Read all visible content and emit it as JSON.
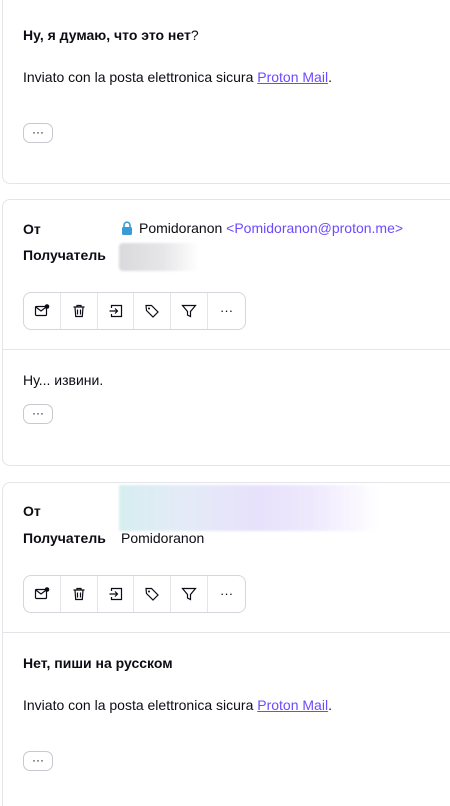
{
  "messages": [
    {
      "body_bold": "Ну, я думаю, что это нет",
      "body_suffix": "?",
      "signature_prefix": "Inviato con la posta elettronica sicura ",
      "signature_link": "Proton Mail",
      "signature_suffix": ".",
      "more_label": "···"
    },
    {
      "from_label": "От",
      "from_name": "Pomidoranon",
      "from_address": "<Pomidoranon@proton.me>",
      "to_label": "Получатель",
      "toolbar_more": "···",
      "body_text": "Ну... извини.",
      "more_label": "···"
    },
    {
      "from_label": "От",
      "to_label": "Получатель",
      "to_name": "Pomidoranon",
      "toolbar_more": "···",
      "body_bold": "Нет, пиши на русском",
      "signature_prefix": "Inviato con la posta elettronica sicura ",
      "signature_link": "Proton Mail",
      "signature_suffix": ".",
      "more_label": "···"
    }
  ],
  "colors": {
    "accent": "#6d4aff",
    "lock": "#3b9bd6",
    "border": "#e5e4e8"
  }
}
